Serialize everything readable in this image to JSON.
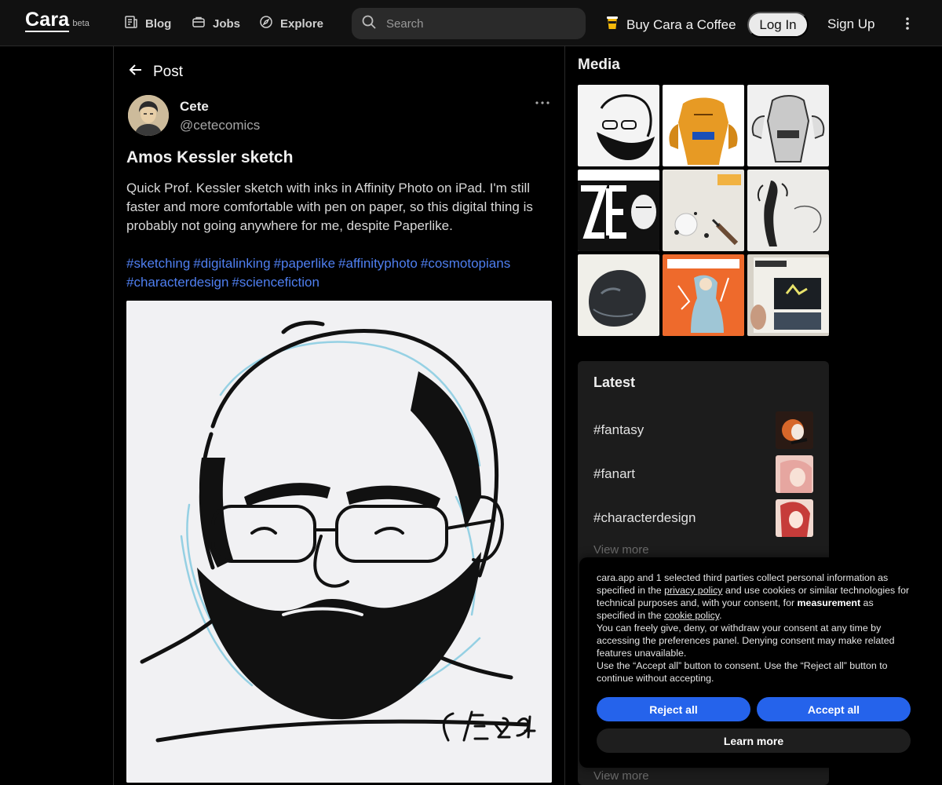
{
  "nav": {
    "logo": "Cara",
    "logo_badge": "beta",
    "links": [
      {
        "label": "Blog",
        "icon": "blog-icon"
      },
      {
        "label": "Jobs",
        "icon": "briefcase-icon"
      },
      {
        "label": "Explore",
        "icon": "compass-icon"
      }
    ],
    "search_placeholder": "Search",
    "coffee_label": "Buy Cara a Coffee",
    "login_label": "Log In",
    "signup_label": "Sign Up"
  },
  "post": {
    "header": "Post",
    "author_name": "Cete",
    "author_handle": "@cetecomics",
    "title": "Amos Kessler sketch",
    "body": "Quick Prof. Kessler sketch with inks in Affinity Photo on iPad. I'm still faster and more comfortable with pen on paper, so this digital thing is probably not going anywhere for me, despite Paperlike.",
    "tags": [
      "#sketching",
      "#digitalinking",
      "#paperlike",
      "#affinityphoto",
      "#cosmotopians",
      "#characterdesign",
      "#sciencefiction"
    ],
    "image_signature": "CETE 2024"
  },
  "sidebar": {
    "media_title": "Media",
    "media_thumbs": [
      "bearded-man-sketch",
      "orange-rock-hero",
      "rock-hero-sketch",
      "zerberus-cover",
      "ink-drawing-photo",
      "creature-sketch",
      "zerberus-creature",
      "cosmotopians-cover",
      "comic-book-photo"
    ],
    "latest_title": "Latest",
    "latest": [
      {
        "tag": "#fantasy"
      },
      {
        "tag": "#fanart"
      },
      {
        "tag": "#characterdesign"
      }
    ],
    "view_more": "View more",
    "view_more_bottom": "View more"
  },
  "consent": {
    "p1_a": "cara.app and 1 selected third parties collect personal information as specified in the ",
    "p1_link1": "privacy policy",
    "p1_b": " and use cookies or similar technologies for technical purposes and, with your consent, for ",
    "p1_bold": "measurement",
    "p1_c": " as specified in the ",
    "p1_link2": "cookie policy",
    "p1_d": ".",
    "p2": "You can freely give, deny, or withdraw your consent at any time by accessing the preferences panel. Denying consent may make related features unavailable.",
    "p3": "Use the “Accept all” button to consent. Use the “Reject all” button to continue without accepting.",
    "reject": "Reject all",
    "accept": "Accept all",
    "learn_more": "Learn more"
  },
  "colors": {
    "accent_blue": "#2563eb",
    "tag_blue": "#4f7ff0",
    "background": "#000000",
    "nav_bg": "#111111",
    "card_bg": "#1c1c1c"
  }
}
